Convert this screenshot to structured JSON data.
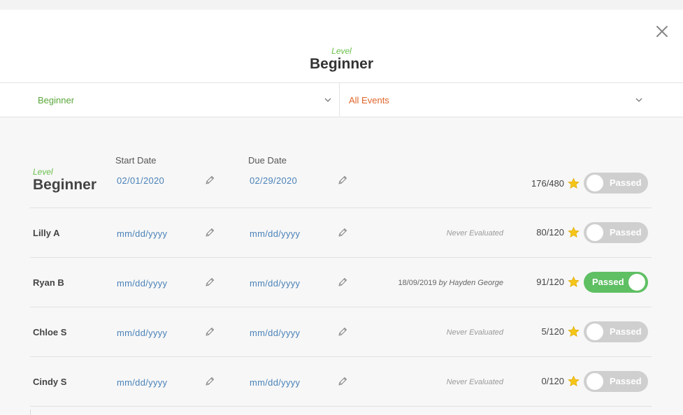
{
  "modal": {
    "close_icon": "close-icon",
    "header": {
      "kicker": "Level",
      "title": "Beginner"
    }
  },
  "filters": {
    "level": {
      "value": "Beginner",
      "color": "#5aa63b"
    },
    "events": {
      "value": "All Events",
      "color": "#e0652b"
    }
  },
  "level_row": {
    "kicker": "Level",
    "title": "Beginner",
    "start_date_header": "Start Date",
    "due_date_header": "Due Date",
    "start_date": "02/01/2020",
    "due_date": "02/29/2020",
    "score": "176/480",
    "toggle_label": "Passed",
    "passed": false
  },
  "students": [
    {
      "name": "Lilly A",
      "start_date": "mm/dd/yyyy",
      "due_date": "mm/dd/yyyy",
      "eval_status": "Never Evaluated",
      "score": "80/120",
      "toggle_label": "Passed",
      "passed": false
    },
    {
      "name": "Ryan B",
      "start_date": "mm/dd/yyyy",
      "due_date": "mm/dd/yyyy",
      "eval_date": "18/09/2019",
      "eval_by_prefix": "by",
      "eval_by": "Hayden George",
      "score": "91/120",
      "toggle_label": "Passed",
      "passed": true
    },
    {
      "name": "Chloe S",
      "start_date": "mm/dd/yyyy",
      "due_date": "mm/dd/yyyy",
      "eval_status": "Never Evaluated",
      "score": "5/120",
      "toggle_label": "Passed",
      "passed": false
    },
    {
      "name": "Cindy S",
      "start_date": "mm/dd/yyyy",
      "due_date": "mm/dd/yyyy",
      "eval_status": "Never Evaluated",
      "score": "0/120",
      "toggle_label": "Passed",
      "passed": false
    }
  ],
  "colors": {
    "accent_green": "#6abf4b",
    "toggle_on": "#5fbf63",
    "toggle_off": "#cfcfcf",
    "date_blue": "#4a82b8",
    "star": "#f5c518"
  }
}
